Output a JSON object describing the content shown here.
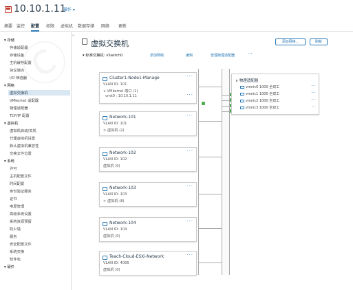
{
  "header": {
    "host": "10.10.1.11",
    "actions_label": "操作 ▾"
  },
  "tabs": [
    "摘要",
    "监控",
    "配置",
    "权限",
    "虚拟机",
    "数据存储",
    "网络",
    "更新"
  ],
  "sidebar": {
    "items": [
      "▾ 存储",
      "存储适配器",
      "存储设备",
      "主机缓存配置",
      "协议端点",
      "I/O 筛选器",
      "▾ 网络",
      "虚拟交换机",
      "VMkernel 适配器",
      "物理适配器",
      "TCP/IP 配置",
      "▾ 虚拟机",
      "虚拟机启动/关机",
      "代理虚拟机设置",
      "默认虚拟机兼容性",
      "交换文件位置",
      "▾ 系统",
      "许可",
      "主机配置文件",
      "时间配置",
      "身份验证服务",
      "证书",
      "电源管理",
      "高级系统设置",
      "系统资源预留",
      "防火墙",
      "服务",
      "安全配置文件",
      "系统交换",
      "软件包",
      "▾ 硬件"
    ]
  },
  "main": {
    "title": "虚拟交换机",
    "add_network_btn": "添加网络...",
    "refresh_btn": "刷新",
    "switch_label": "▾ 标准交换机: vSwitch0",
    "links": [
      "添加网络",
      "编辑",
      "管理物理适配器",
      "···"
    ],
    "portgroups": [
      {
        "name": "Cluster1-Node1-Manage",
        "vlan": "VLAN ID: 101",
        "sub": "∨ VMkernel 端口 (1)",
        "sub2": "vmk0 : 10.10.1.11"
      },
      {
        "name": "Network-101",
        "vlan": "VLAN ID: 101",
        "sub": "> 虚拟机 (2)"
      },
      {
        "name": "Network-102",
        "vlan": "VLAN ID: 102",
        "sub": "虚拟机 (0)"
      },
      {
        "name": "Network-103",
        "vlan": "VLAN ID: 103",
        "sub": "> 虚拟机 (8)"
      },
      {
        "name": "Network-104",
        "vlan": "VLAN ID: 104",
        "sub": "虚拟机 (0)"
      },
      {
        "name": "Teach-Cloud-ESXi-Network",
        "vlan": "VLAN ID: 4095",
        "sub": "虚拟机 (0)"
      }
    ],
    "uplinks": {
      "title": "∨ 物理适配器",
      "nics": [
        "vmnic0 1000 全双工",
        "vmnic1 1000 全双工",
        "vmnic2 1000 全双工",
        "vmnic3 1000 全双工"
      ]
    },
    "dots": "···"
  },
  "icons": [
    "host-icon",
    "switch-icon",
    "network-icon",
    "nic-icon",
    "more-icon"
  ],
  "colors": {
    "accent": "#2a7ab8",
    "selected": "#d9e7f3",
    "status_green": "#4caf50",
    "host_red": "#c0392b"
  }
}
